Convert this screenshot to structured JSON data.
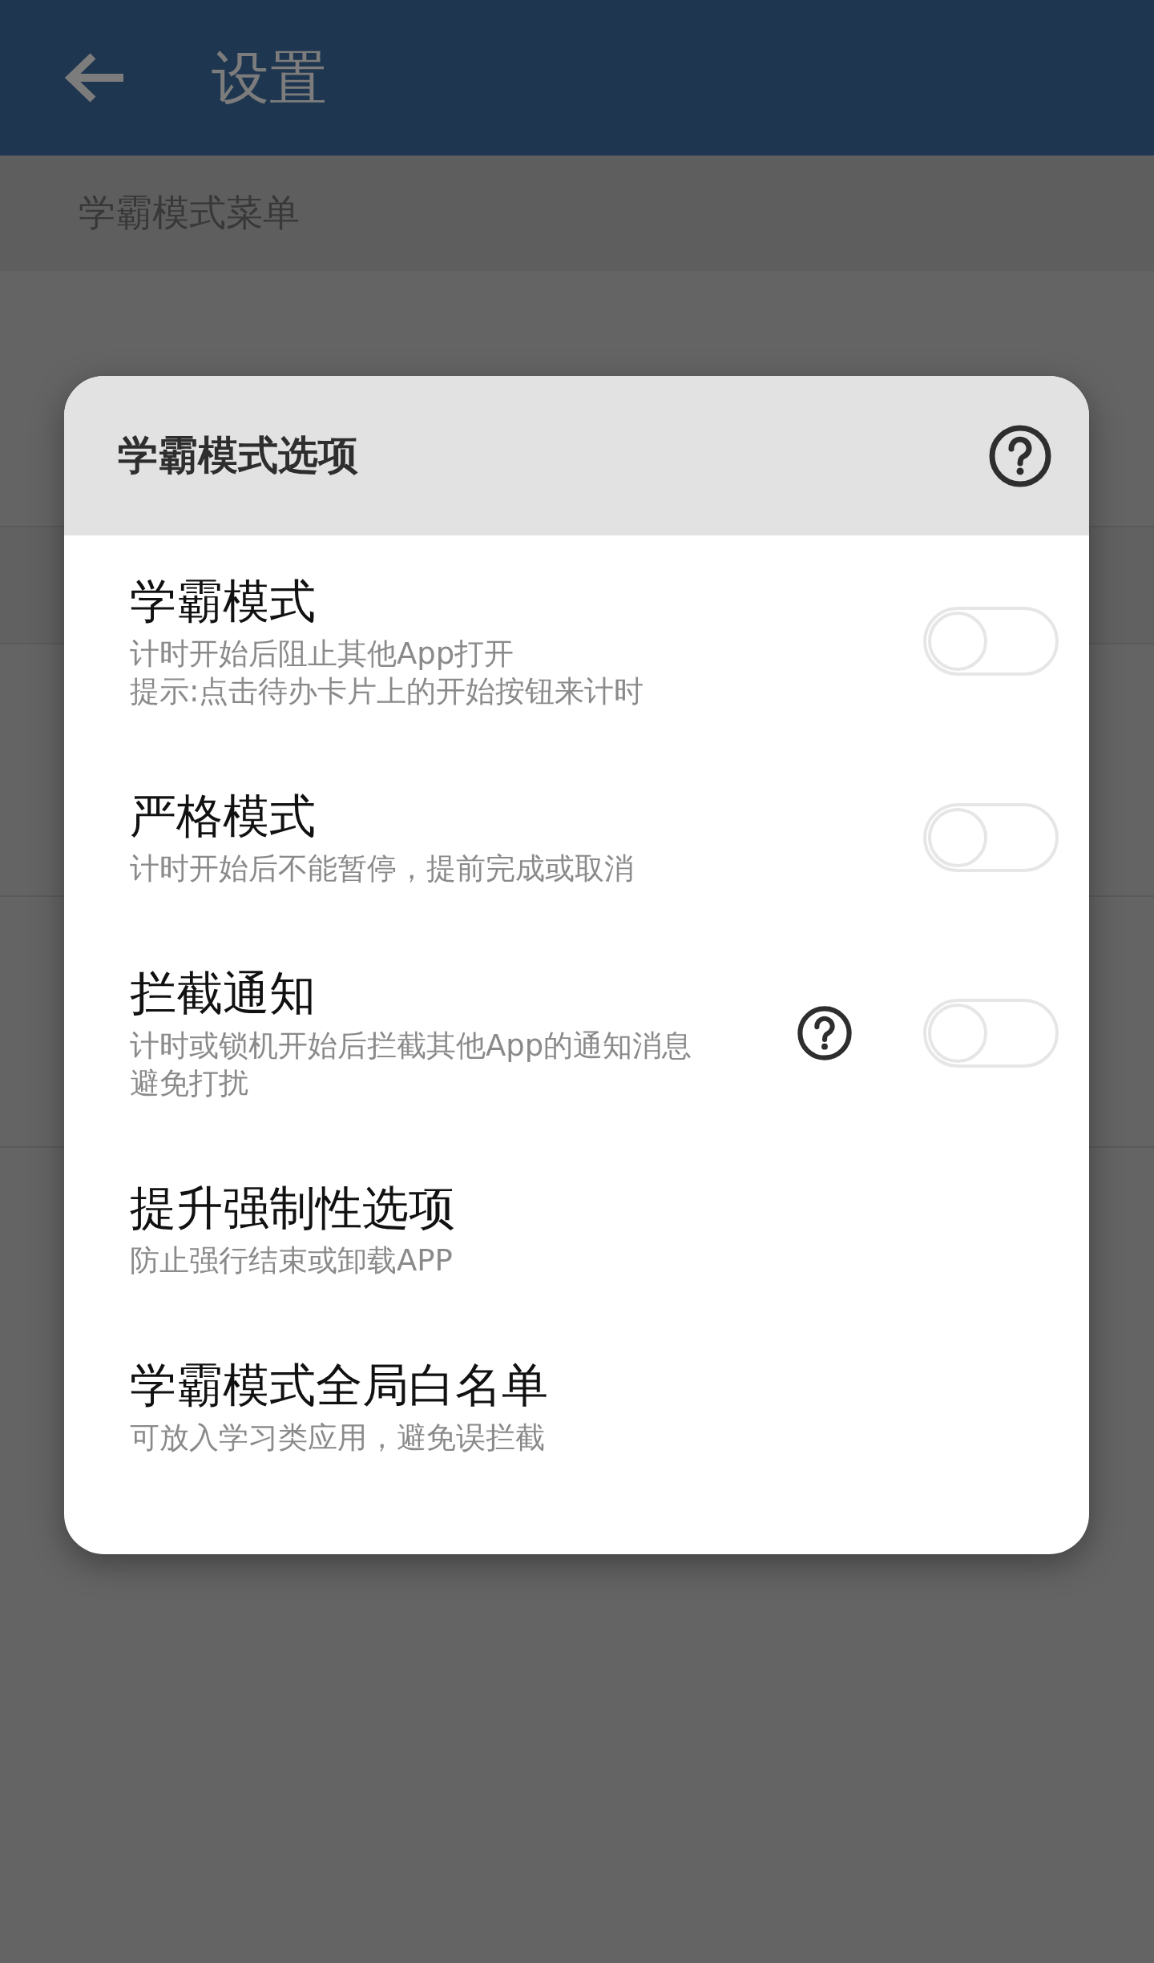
{
  "app_bar": {
    "title": "设置"
  },
  "section_header": "学霸模式菜单",
  "dialog": {
    "title": "学霸模式选项",
    "options": [
      {
        "kind": "switch",
        "title": "学霸模式",
        "description": [
          "计时开始后阻止其他App打开",
          "提示:点击待办卡片上的开始按钮来计时"
        ],
        "help": false,
        "on": false
      },
      {
        "kind": "switch",
        "title": "严格模式",
        "description": [
          "计时开始后不能暂停，提前完成或取消"
        ],
        "help": false,
        "on": false
      },
      {
        "kind": "switch",
        "title": "拦截通知",
        "description": [
          "计时或锁机开始后拦截其他App的通知消息",
          "避免打扰"
        ],
        "help": true,
        "on": false
      },
      {
        "kind": "link",
        "title": "提升强制性选项",
        "description": [
          "防止强行结束或卸载APP"
        ],
        "help": false
      },
      {
        "kind": "link",
        "title": "学霸模式全局白名单",
        "description": [
          "可放入学习类应用，避免误拦截"
        ],
        "help": false
      }
    ]
  }
}
